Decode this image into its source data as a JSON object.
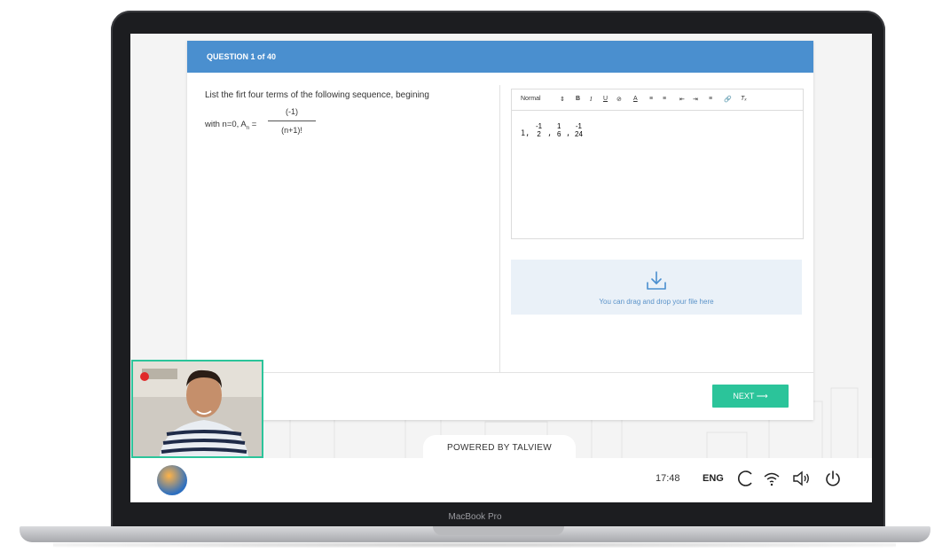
{
  "device": {
    "label": "MacBook Pro"
  },
  "exam": {
    "header": "QUESTION 1 of 40",
    "question_line1": "List the firt four terms of the following sequence, begining",
    "question_line2_prefix": "with n=0, A",
    "subscript": "n",
    "equals": " = ",
    "fraction_numerator": "(-1)",
    "fraction_denominator": "(n+1)!"
  },
  "editor": {
    "format_select": "Normal",
    "answer_first": "1,",
    "answer_terms": [
      {
        "num": "-1",
        "den": "2"
      },
      {
        "num": "1",
        "den": "6"
      },
      {
        "num": "-1",
        "den": "24"
      }
    ]
  },
  "dropzone": {
    "label": "You can drag and drop your file here"
  },
  "buttons": {
    "next": "NEXT"
  },
  "footer": {
    "powered_by": "POWERED BY TALVIEW"
  },
  "taskbar": {
    "time": "17:48",
    "language": "ENG"
  },
  "colors": {
    "header_blue": "#4a8fcf",
    "accent_green": "#2bc49a",
    "dropzone_bg": "#eaf1f8"
  }
}
